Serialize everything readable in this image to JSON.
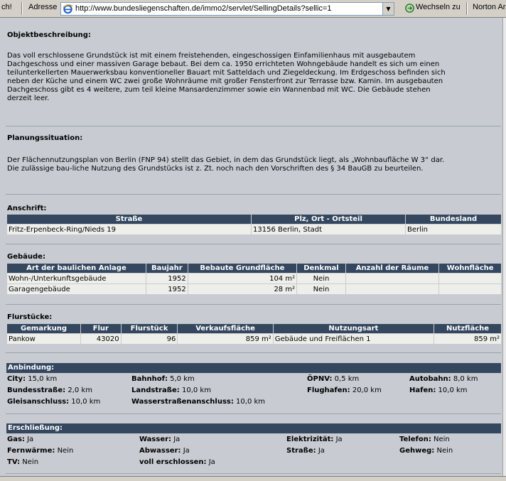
{
  "browser": {
    "left_fragment": "ch!",
    "address_label": "Adresse",
    "url": "http://www.bundesliegenschaften.de/immo2/servlet/SellingDetails?sellic=1",
    "go_label": "Wechseln zu",
    "toolbar_fragment": "Norton Ar"
  },
  "objekt": {
    "title": "Objektbeschreibung:",
    "lines": [
      "Das voll erschlossene Grundstück ist mit einem freistehenden, eingeschossigen Einfamilienhaus mit ausgebautem",
      "Dachgeschoss und einer massiven Garage bebaut. Bei dem ca. 1950 errichteten Wohngebäude handelt es sich um einen",
      "teilunterkellerten Mauerwerksbau konventioneller Bauart mit Satteldach und Ziegeldeckung. Im Erdgeschoss befinden sich",
      "neben der Küche und einem WC zwei große Wohnräume mit großer Fensterfront zur Terrasse bzw. Kamin. Im ausgebauten",
      "Dachgeschoss gibt es 4 weitere, zum teil kleine Mansardenzimmer sowie ein Wannenbad mit WC. Die Gebäude stehen",
      "derzeit leer."
    ]
  },
  "planung": {
    "title": "Planungssituation:",
    "lines": [
      "Der Flächennutzungsplan von Berlin (FNP 94) stellt das Gebiet, in dem das Grundstück liegt, als „Wohnbaufläche W 3“ dar.",
      "Die zulässige bau-liche Nutzung des Grundstücks ist z. Zt. noch nach den Vorschriften des § 34 BauGB zu beurteilen."
    ]
  },
  "anschrift": {
    "title": "Anschrift:",
    "headers": [
      "Straße",
      "Plz, Ort - Ortsteil",
      "Bundesland"
    ],
    "row": [
      "Fritz-Erpenbeck-Ring/Nieds 19",
      "13156 Berlin, Stadt",
      "Berlin"
    ]
  },
  "gebaeude": {
    "title": "Gebäude:",
    "headers": [
      "Art der baulichen Anlage",
      "Baujahr",
      "Bebaute Grundfläche",
      "Denkmal",
      "Anzahl der Räume",
      "Wohnfläche"
    ],
    "rows": [
      [
        "Wohn-/Unterkunftsgebäude",
        "1952",
        "104 m²",
        "Nein",
        "",
        ""
      ],
      [
        "Garagengebäude",
        "1952",
        "28 m²",
        "Nein",
        "",
        ""
      ]
    ]
  },
  "flurstuecke": {
    "title": "Flurstücke:",
    "headers": [
      "Gemarkung",
      "Flur",
      "Flurstück",
      "Verkaufsfläche",
      "Nutzungsart",
      "Nutzfläche"
    ],
    "row": [
      "Pankow",
      "43020",
      "96",
      "859 m²",
      "Gebäude und Freiflächen 1",
      "859 m²"
    ]
  },
  "anbindung": {
    "title": "Anbindung:",
    "items": [
      {
        "k": "City:",
        "v": " 15,0 km"
      },
      {
        "k": "Bahnhof:",
        "v": " 5,0 km"
      },
      {
        "k": "ÖPNV:",
        "v": " 0,5 km"
      },
      {
        "k": "Autobahn:",
        "v": " 8,0 km"
      },
      {
        "k": "Bundesstraße:",
        "v": " 2,0 km"
      },
      {
        "k": "Landstraße:",
        "v": " 10,0 km"
      },
      {
        "k": "Flughafen:",
        "v": " 20,0 km"
      },
      {
        "k": "Hafen:",
        "v": " 10,0 km"
      },
      {
        "k": "Gleisanschluss:",
        "v": " 10,0 km"
      },
      {
        "k": "Wasserstraßenanschluss:",
        "v": " 10,0 km"
      }
    ]
  },
  "erschliessung": {
    "title": "Erschließung:",
    "items": [
      {
        "k": "Gas:",
        "v": " Ja"
      },
      {
        "k": "Wasser:",
        "v": " Ja"
      },
      {
        "k": "Elektrizität:",
        "v": " Ja"
      },
      {
        "k": "Telefon:",
        "v": " Nein"
      },
      {
        "k": "Fernwärme:",
        "v": " Nein"
      },
      {
        "k": "Abwasser:",
        "v": " Ja"
      },
      {
        "k": "Straße:",
        "v": " Ja"
      },
      {
        "k": "Gehweg:",
        "v": " Nein"
      },
      {
        "k": "TV:",
        "v": " Nein"
      },
      {
        "k": "voll erschlossen:",
        "v": " Ja"
      }
    ]
  }
}
